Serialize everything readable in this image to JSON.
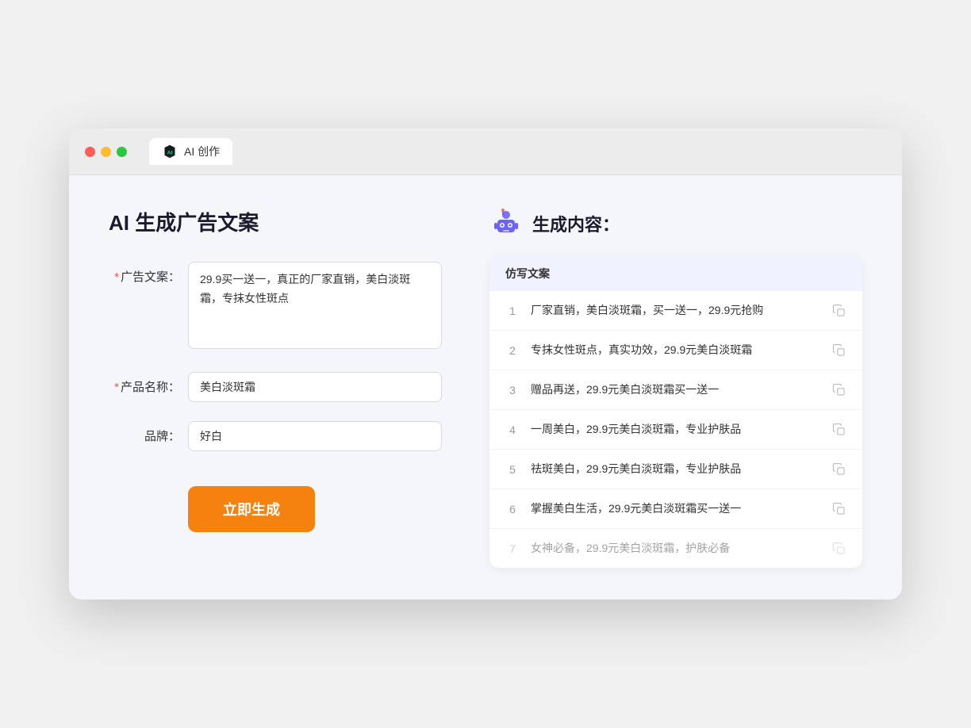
{
  "titleBar": {
    "tabLabel": "AI 创作"
  },
  "leftPanel": {
    "pageTitle": "AI 生成广告文案",
    "form": {
      "adCopyLabel": "广告文案：",
      "adCopyRequired": true,
      "adCopyValue": "29.9买一送一，真正的厂家直销，美白淡斑霜，专抹女性斑点",
      "productNameLabel": "产品名称：",
      "productNameRequired": true,
      "productNameValue": "美白淡斑霜",
      "brandLabel": "品牌：",
      "brandRequired": false,
      "brandValue": "好白"
    },
    "generateButton": "立即生成"
  },
  "rightPanel": {
    "resultTitle": "生成内容：",
    "tableHeader": "仿写文案",
    "rows": [
      {
        "num": "1",
        "text": "厂家直销，美白淡斑霜，买一送一，29.9元抢购",
        "dimmed": false
      },
      {
        "num": "2",
        "text": "专抹女性斑点，真实功效，29.9元美白淡斑霜",
        "dimmed": false
      },
      {
        "num": "3",
        "text": "赠品再送，29.9元美白淡斑霜买一送一",
        "dimmed": false
      },
      {
        "num": "4",
        "text": "一周美白，29.9元美白淡斑霜，专业护肤品",
        "dimmed": false
      },
      {
        "num": "5",
        "text": "祛斑美白，29.9元美白淡斑霜，专业护肤品",
        "dimmed": false
      },
      {
        "num": "6",
        "text": "掌握美白生活，29.9元美白淡斑霜买一送一",
        "dimmed": false
      },
      {
        "num": "7",
        "text": "女神必备，29.9元美白淡斑霜，护肤必备",
        "dimmed": true
      }
    ]
  }
}
